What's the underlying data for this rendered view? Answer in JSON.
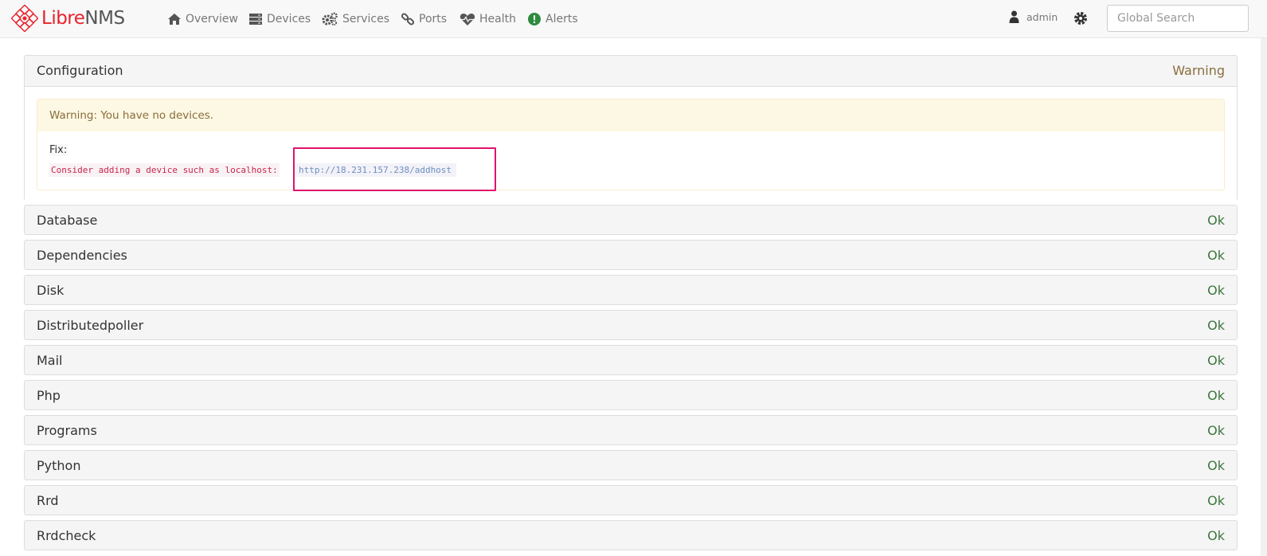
{
  "brand": {
    "part1": "Libre",
    "part2": "NMS"
  },
  "nav": {
    "overview": "Overview",
    "devices": "Devices",
    "services": "Services",
    "ports": "Ports",
    "health": "Health",
    "alerts": "Alerts"
  },
  "user": {
    "name": "admin"
  },
  "search": {
    "placeholder": "Global Search"
  },
  "config": {
    "title": "Configuration",
    "status": "Warning",
    "warning_text": "Warning: You have no devices.",
    "fix_label": "Fix:",
    "fix_text": "Consider adding a device such as localhost:",
    "fix_link": "http://18.231.157.238/addhost"
  },
  "checks": [
    {
      "title": "Database",
      "status": "Ok"
    },
    {
      "title": "Dependencies",
      "status": "Ok"
    },
    {
      "title": "Disk",
      "status": "Ok"
    },
    {
      "title": "Distributedpoller",
      "status": "Ok"
    },
    {
      "title": "Mail",
      "status": "Ok"
    },
    {
      "title": "Php",
      "status": "Ok"
    },
    {
      "title": "Programs",
      "status": "Ok"
    },
    {
      "title": "Python",
      "status": "Ok"
    },
    {
      "title": "Rrd",
      "status": "Ok"
    },
    {
      "title": "Rrdcheck",
      "status": "Ok"
    }
  ],
  "colors": {
    "brand_red": "#e8222c",
    "ok_green": "#3c763d",
    "warning_brown": "#8a6d3b",
    "highlight": "#e0146e"
  }
}
